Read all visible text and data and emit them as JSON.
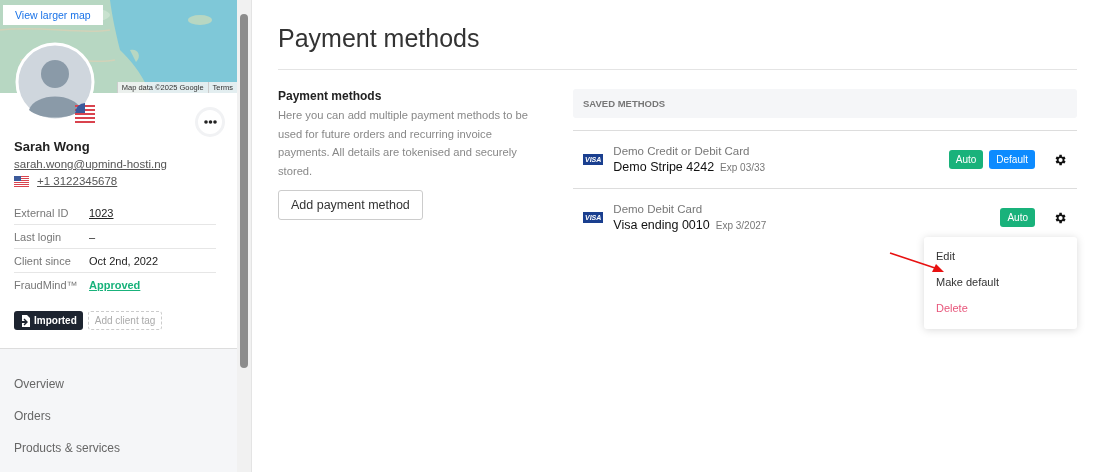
{
  "map": {
    "kind": "picture",
    "link": "View larger map",
    "attribution": [
      "Map data ©2025 Google",
      "Terms"
    ]
  },
  "client": {
    "name": "Sarah Wong",
    "email": "sarah.wong@upmind-hosti.ng",
    "phone": "+1 3122345678",
    "details": [
      {
        "label": "External ID",
        "value": "1023",
        "kind": "link"
      },
      {
        "label": "Last login",
        "value": "–",
        "kind": "text"
      },
      {
        "label": "Client since",
        "value": "Oct 2nd, 2022",
        "kind": "text"
      },
      {
        "label": "FraudMind™",
        "value": "Approved",
        "kind": "status"
      }
    ],
    "tags": [
      "Imported"
    ],
    "tag_placeholder": "Add client tag"
  },
  "nav": [
    {
      "label": "Overview"
    },
    {
      "label": "Orders"
    },
    {
      "label": "Products & services"
    }
  ],
  "page_title": "Payment methods",
  "intro": {
    "heading": "Payment methods",
    "text": "Here you can add multiple payment methods to be used for future orders and recurring invoice payments. All details are tokenised and securely stored.",
    "button": "Add payment method"
  },
  "saved": {
    "heading": "SAVED METHODS",
    "methods": [
      {
        "brand": "VISA",
        "type": "Demo Credit or Debit Card",
        "name": "Demo Stripe 4242",
        "expiry": "Exp 03/33",
        "badges": [
          {
            "label": "Auto",
            "kind": "auto"
          },
          {
            "label": "Default",
            "kind": "default"
          }
        ]
      },
      {
        "brand": "VISA",
        "type": "Demo Debit Card",
        "name": "Visa ending 0010",
        "expiry": "Exp 3/2027",
        "badges": [
          {
            "label": "Auto",
            "kind": "auto"
          }
        ]
      }
    ]
  },
  "menu": [
    {
      "label": "Edit",
      "kind": "normal"
    },
    {
      "label": "Make default",
      "kind": "normal"
    },
    {
      "label": "Delete",
      "kind": "danger"
    }
  ]
}
